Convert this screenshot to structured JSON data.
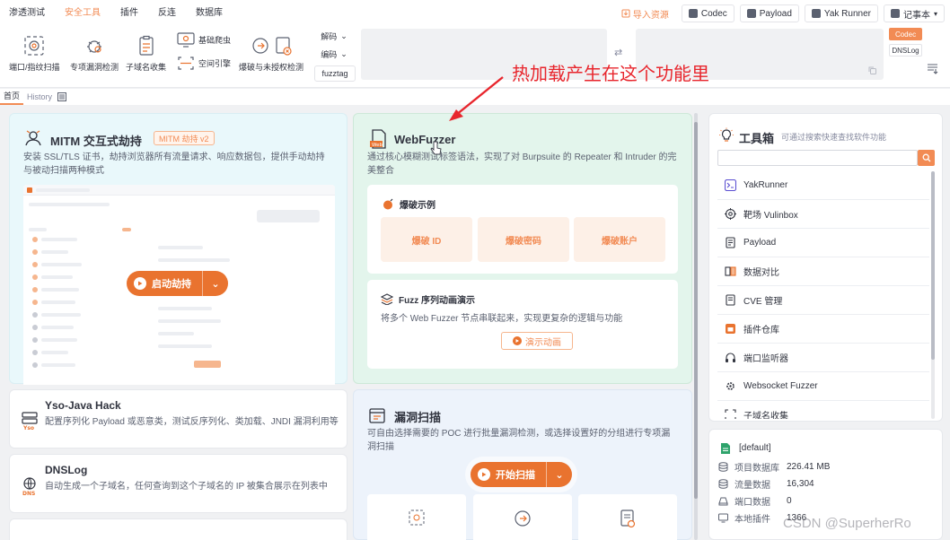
{
  "menu": {
    "items": [
      "渗透测试",
      "安全工具",
      "插件",
      "反连",
      "数据库"
    ],
    "active_index": 1
  },
  "top_right": {
    "import_label": "导入资源",
    "codec_label": "Codec",
    "payload_label": "Payload",
    "yakrunner_label": "Yak Runner",
    "notepad_label": "记事本"
  },
  "toolbar": {
    "tools": [
      {
        "label": "端口/指纹扫描",
        "icon": "fingerprint-icon"
      },
      {
        "label": "专项漏洞检测",
        "icon": "bug-icon"
      },
      {
        "label": "子域名收集",
        "icon": "clipboard-icon"
      },
      {
        "label": "爆破与未授权检测",
        "icon": "key-icon"
      }
    ],
    "small_tools": [
      {
        "label": "基础爬虫",
        "icon": "monitor-icon"
      },
      {
        "label": "空间引擎",
        "icon": "scan-icon"
      }
    ],
    "decode_label": "解码",
    "encode_label": "编码",
    "fuzztag_label": "fuzztag",
    "codec_tag": "Codec",
    "dnslog_tag": "DNSLog"
  },
  "tabs": [
    {
      "label": "首页",
      "active": true
    },
    {
      "label": "History",
      "active": false
    }
  ],
  "annotation": "热加载产生在这个功能里",
  "mitm": {
    "title": "MITM 交互式劫持",
    "badge": "MITM 劫持 v2",
    "desc": "安装 SSL/TLS 证书，劫持浏览器所有流量请求、响应数据包，提供手动劫持与被动扫描两种模式",
    "start_label": "启动劫持"
  },
  "webfuzzer": {
    "title": "WebFuzzer",
    "desc": "通过核心模糊测试标签语法，实现了对 Burpsuite 的 Repeater 和 Intruder 的完美整合",
    "examples_title": "爆破示例",
    "examples": [
      "爆破 ID",
      "爆破密码",
      "爆破账户"
    ],
    "sequence_title": "Fuzz 序列动画演示",
    "sequence_desc": "将多个 Web Fuzzer 节点串联起来，实现更复杂的逻辑与功能",
    "demo_label": "演示动画"
  },
  "vuln": {
    "title": "漏洞扫描",
    "desc": "可自由选择需要的 POC 进行批量漏洞检测，或选择设置好的分组进行专项漏洞扫描",
    "start_label": "开始扫描"
  },
  "yso": {
    "title": "Yso-Java Hack",
    "desc": "配置序列化 Payload 或恶意类，测试反序列化、类加载、JNDI 漏洞利用等"
  },
  "dnslog": {
    "title": "DNSLog",
    "desc": "自动生成一个子域名，任何查询到这个子域名的 IP 被集合展示在列表中"
  },
  "toolbox": {
    "title": "工具箱",
    "subtitle": "可通过搜索快速查找软件功能",
    "items": [
      {
        "label": "YakRunner",
        "icon": "terminal-icon"
      },
      {
        "label": "靶场 Vulinbox",
        "icon": "target-icon"
      },
      {
        "label": "Payload",
        "icon": "file-icon"
      },
      {
        "label": "数据对比",
        "icon": "compare-icon"
      },
      {
        "label": "CVE 管理",
        "icon": "document-icon"
      },
      {
        "label": "插件仓库",
        "icon": "store-icon"
      },
      {
        "label": "端口监听器",
        "icon": "headset-icon"
      },
      {
        "label": "Websocket Fuzzer",
        "icon": "gear-icon"
      },
      {
        "label": "子域名收集",
        "icon": "scan-icon"
      }
    ]
  },
  "project": {
    "name": "[default]",
    "rows": [
      {
        "label": "项目数据库",
        "value": "226.41 MB",
        "icon": "database-icon"
      },
      {
        "label": "流量数据",
        "value": "16,304",
        "icon": "database-icon"
      },
      {
        "label": "端口数据",
        "value": "0",
        "icon": "disk-icon"
      },
      {
        "label": "本地插件",
        "value": "1366",
        "icon": "monitor-icon"
      }
    ]
  },
  "watermark": "CSDN @SuperherRo",
  "colors": {
    "accent": "#f28b54",
    "accent_dark": "#e9732f",
    "annotation": "#e8262d"
  }
}
